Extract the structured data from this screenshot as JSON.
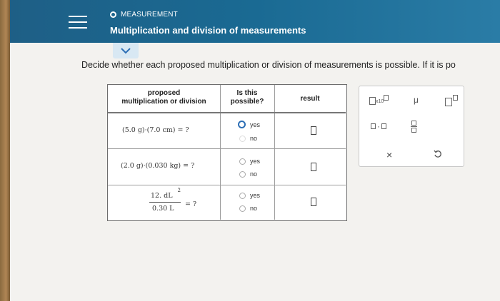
{
  "header": {
    "section_label": "MEASUREMENT",
    "title": "Multiplication and division of measurements"
  },
  "instructions": "Decide whether each proposed multiplication or division of measurements is possible. If it is po",
  "table": {
    "headers": {
      "proposed": "proposed",
      "proposed_line2": "multiplication or division",
      "possible": "Is this",
      "possible_line2": "possible?",
      "result": "result"
    },
    "rows": [
      {
        "expression": "(5.0 g)·(7.0 cm) = ?",
        "yes": "yes",
        "no": "no"
      },
      {
        "expression": "(2.0 g)·(0.030 kg) = ?",
        "yes": "yes",
        "no": "no"
      },
      {
        "numerator": "12. dL",
        "exponent": "2",
        "denominator": "0.30 L",
        "equals": "= ?",
        "yes": "yes",
        "no": "no"
      }
    ]
  },
  "tools": {
    "x10": "x10",
    "mu": "μ",
    "times": "×",
    "dot": "·"
  },
  "colors": {
    "header_bg": "#1e5f86",
    "radio_selected": "#2d6fb5"
  }
}
